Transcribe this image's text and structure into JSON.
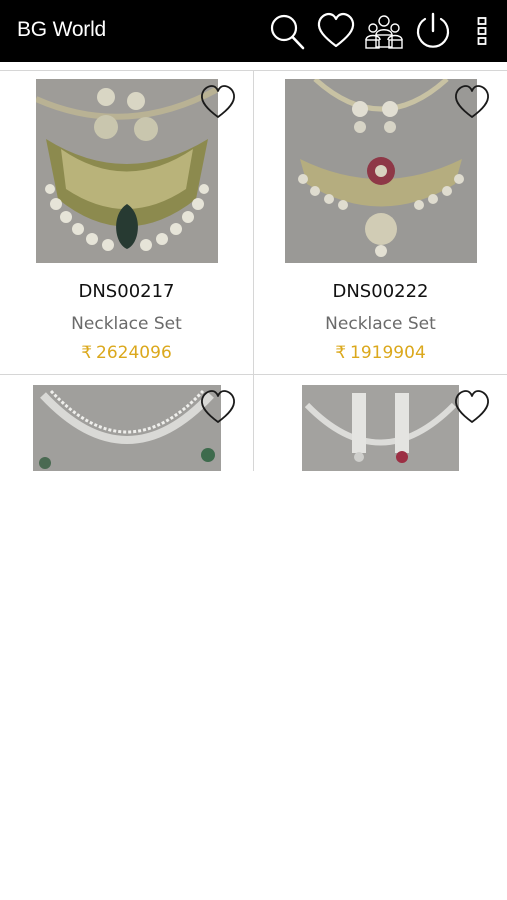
{
  "app": {
    "title": "BG World"
  },
  "toolbar": {
    "icons": [
      "search-icon",
      "heart-icon",
      "people-icon",
      "power-icon",
      "more-vert-icon"
    ]
  },
  "products": [
    {
      "code": "DNS00217",
      "category": "Necklace Set",
      "currency": "₹",
      "price": "2624096",
      "favorite": false
    },
    {
      "code": "DNS00222",
      "category": "Necklace Set",
      "currency": "₹",
      "price": "1919904",
      "favorite": false
    },
    {
      "favorite": false
    },
    {
      "favorite": false
    }
  ],
  "colors": {
    "appbar": "#000000",
    "price": "#dba81c",
    "divider": "#d6d6d6",
    "category": "#6a6a6a"
  }
}
